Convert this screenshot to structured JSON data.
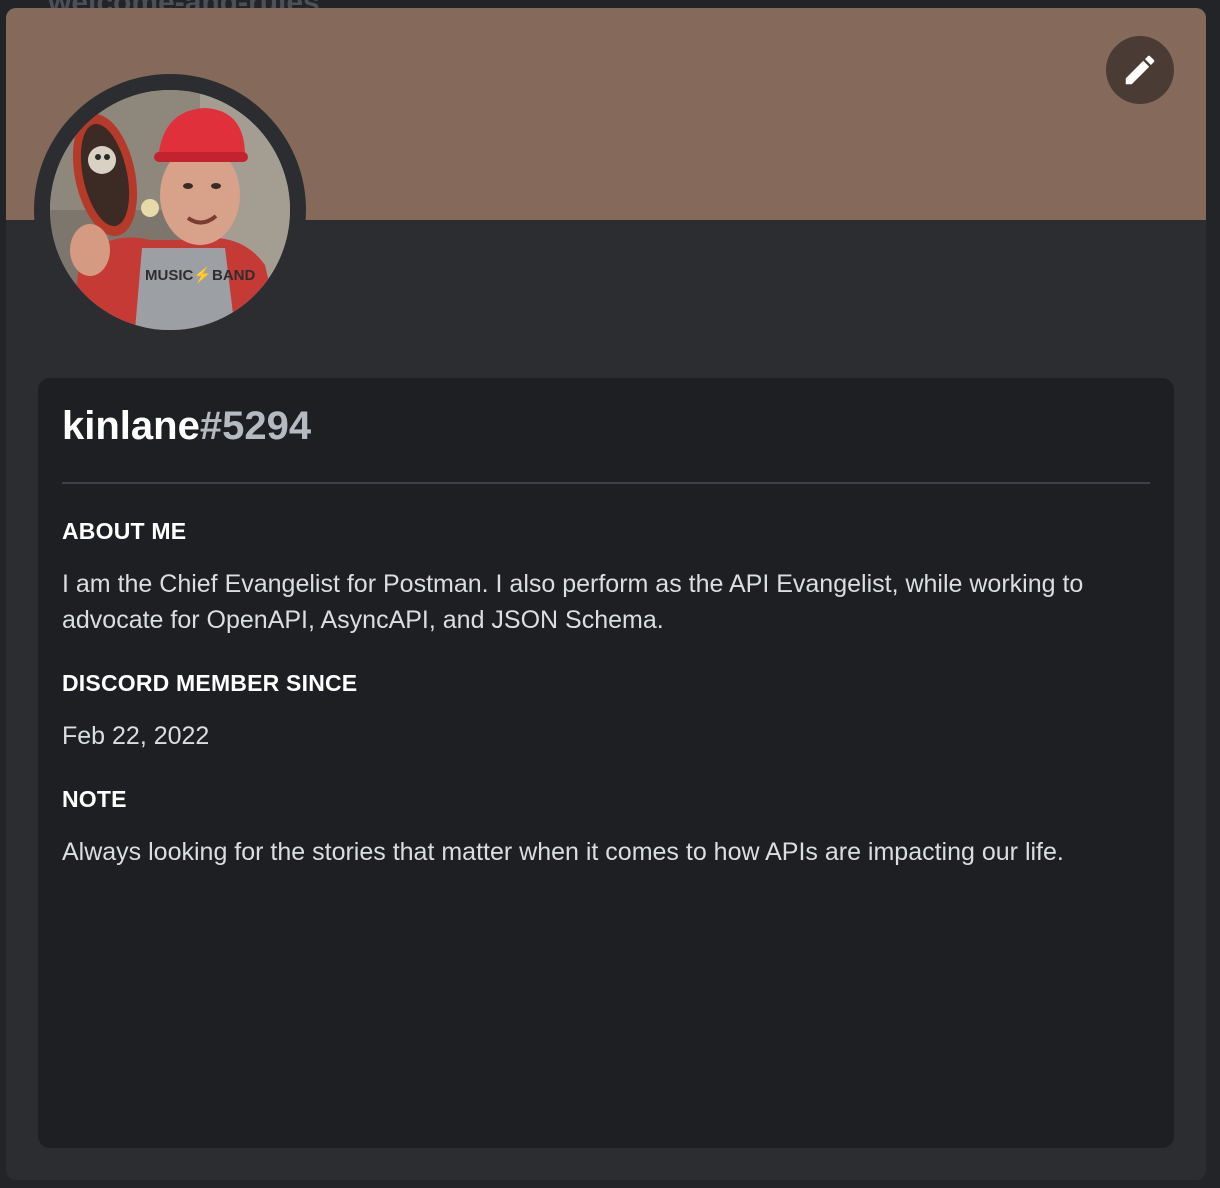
{
  "backdrop": {
    "channel_name": "welcome-and-rules"
  },
  "profile": {
    "username": "kinlane",
    "discriminator": "#5294",
    "banner_color": "#856a5c",
    "avatar_alt": "Profile avatar",
    "edit_icon": "pencil-icon"
  },
  "sections": {
    "about_me": {
      "heading": "ABOUT ME",
      "text": "I am the Chief Evangelist for Postman. I also perform as the API Evangelist, while working to advocate for OpenAPI, AsyncAPI, and JSON Schema."
    },
    "member_since": {
      "heading": "DISCORD MEMBER SINCE",
      "text": "Feb 22, 2022"
    },
    "note": {
      "heading": "NOTE",
      "text": "Always looking for the stories that matter when it comes to how APIs are impacting our life."
    }
  }
}
